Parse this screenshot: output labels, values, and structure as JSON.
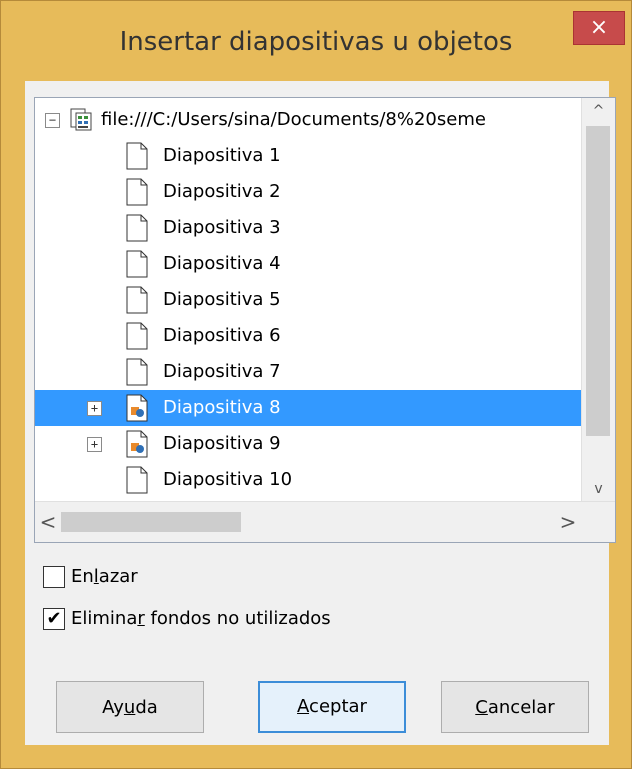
{
  "dialog": {
    "title": "Insertar diapositivas u objetos",
    "close_glyph": "×"
  },
  "tree": {
    "root": {
      "label": "file:///C:/Users/sina/Documents/8%20seme",
      "expanded": true,
      "expander": "−",
      "icon": "document-grid-icon"
    },
    "items": [
      {
        "label": "Diapositiva 1"
      },
      {
        "label": "Diapositiva 2"
      },
      {
        "label": "Diapositiva 3"
      },
      {
        "label": "Diapositiva 4"
      },
      {
        "label": "Diapositiva 5"
      },
      {
        "label": "Diapositiva 6"
      },
      {
        "label": "Diapositiva 7"
      },
      {
        "label": "Diapositiva 8",
        "expander": "+",
        "selected": true
      },
      {
        "label": "Diapositiva 9",
        "expander": "+"
      },
      {
        "label": "Diapositiva 10"
      }
    ],
    "vscroll": {
      "up": "^",
      "down": "v"
    },
    "hscroll": {
      "left": "<",
      "right": ">"
    }
  },
  "options": {
    "link": {
      "pre": "En",
      "accel": "l",
      "post": "azar",
      "checked": false,
      "mark": ""
    },
    "remove_bg": {
      "pre": "Elimina",
      "accel": "r",
      "post": " fondos no utilizados",
      "checked": true,
      "mark": "✔"
    }
  },
  "buttons": {
    "help": {
      "pre": "Ay",
      "accel": "u",
      "post": "da"
    },
    "ok": {
      "pre": "",
      "accel": "A",
      "post": "ceptar"
    },
    "cancel": {
      "pre": "",
      "accel": "C",
      "post": "ancelar"
    }
  },
  "colors": {
    "titlebar": "#e7bb5a",
    "selection": "#3399ff",
    "close": "#c74b4b"
  }
}
